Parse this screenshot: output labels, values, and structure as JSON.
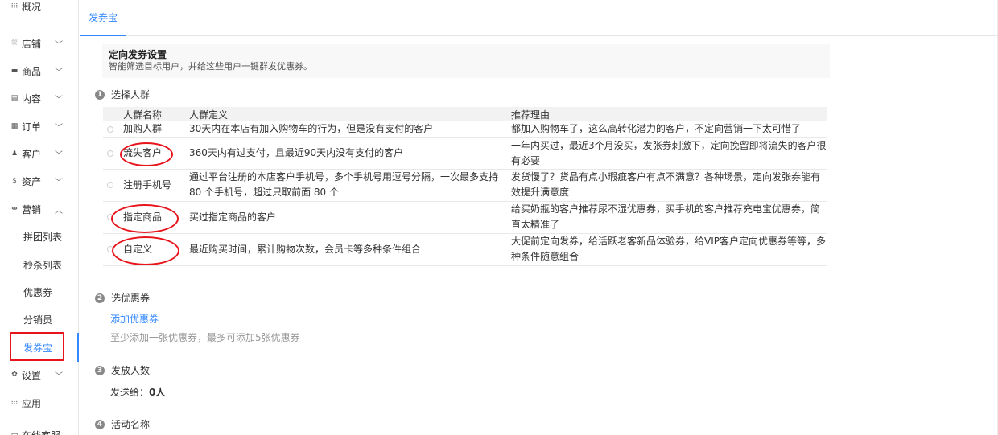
{
  "sidebar": {
    "top_partial_label": "概况",
    "items": [
      {
        "label": "店铺",
        "icon": "store-icon",
        "glyph": "⛆"
      },
      {
        "label": "商品",
        "icon": "goods-icon",
        "glyph": "▬"
      },
      {
        "label": "内容",
        "icon": "content-icon",
        "glyph": "▤"
      },
      {
        "label": "订单",
        "icon": "order-icon",
        "glyph": "▦"
      },
      {
        "label": "客户",
        "icon": "customer-icon",
        "glyph": "♟"
      },
      {
        "label": "资产",
        "icon": "asset-icon",
        "glyph": "$"
      },
      {
        "label": "营销",
        "icon": "marketing-icon",
        "glyph": "⇼"
      }
    ],
    "marketing_subs": [
      "拼团列表",
      "秒杀列表",
      "优惠券",
      "分销员",
      "发券宝"
    ],
    "settings_label": "设置",
    "apps_label": "应用",
    "service_label": "在线客服"
  },
  "tab": {
    "label": "发券宝"
  },
  "info": {
    "title": "定向发券设置",
    "desc": "智能筛选目标用户，并给这些用户一键群发优惠券。"
  },
  "steps": {
    "s1": {
      "num": "1",
      "label": "选择人群"
    },
    "s2": {
      "num": "2",
      "label": "选优惠券"
    },
    "s3": {
      "num": "3",
      "label": "发放人数"
    },
    "s4": {
      "num": "4",
      "label": "活动名称"
    }
  },
  "table": {
    "headers": {
      "name": "人群名称",
      "def": "人群定义",
      "reason": "推荐理由"
    },
    "rows": [
      {
        "name": "加购人群",
        "def": "30天内在本店有加入购物车的行为，但是没有支付的客户",
        "reason": "都加入购物车了，这么高转化潜力的客户，不定向营销一下太可惜了"
      },
      {
        "name": "流失客户",
        "def": "360天内有过支付，且最近90天内没有支付的客户",
        "reason": "一年内买过，最近3个月没买，发张券刺激下，定向挽留即将流失的客户很有必要"
      },
      {
        "name": "注册手机号",
        "def": "通过平台注册的本店客户手机号，多个手机号用逗号分隔，一次最多支持 80 个手机号，超过只取前面 80 个",
        "reason": "发货慢了？货品有点小瑕疵客户有点不满意？各种场景，定向发张券能有效提升满意度"
      },
      {
        "name": "指定商品",
        "def": "买过指定商品的客户",
        "reason": "给买奶瓶的客户推荐尿不湿优惠券，买手机的客户推荐充电宝优惠券，简直太精准了"
      },
      {
        "name": "自定义",
        "def": "最近购买时间，累计购物次数，会员卡等多种条件组合",
        "reason": "大促前定向发券，给活跃老客新品体验券，给VIP客户定向优惠券等等，多种条件随意组合"
      }
    ]
  },
  "coupon": {
    "add_link": "添加优惠券",
    "hint": "至少添加一张优惠券，最多可添加5张优惠券"
  },
  "send": {
    "label": "发送给：",
    "value": "0人"
  },
  "colors": {
    "accent": "#3388ff",
    "annotation_red": "#e8141c"
  }
}
